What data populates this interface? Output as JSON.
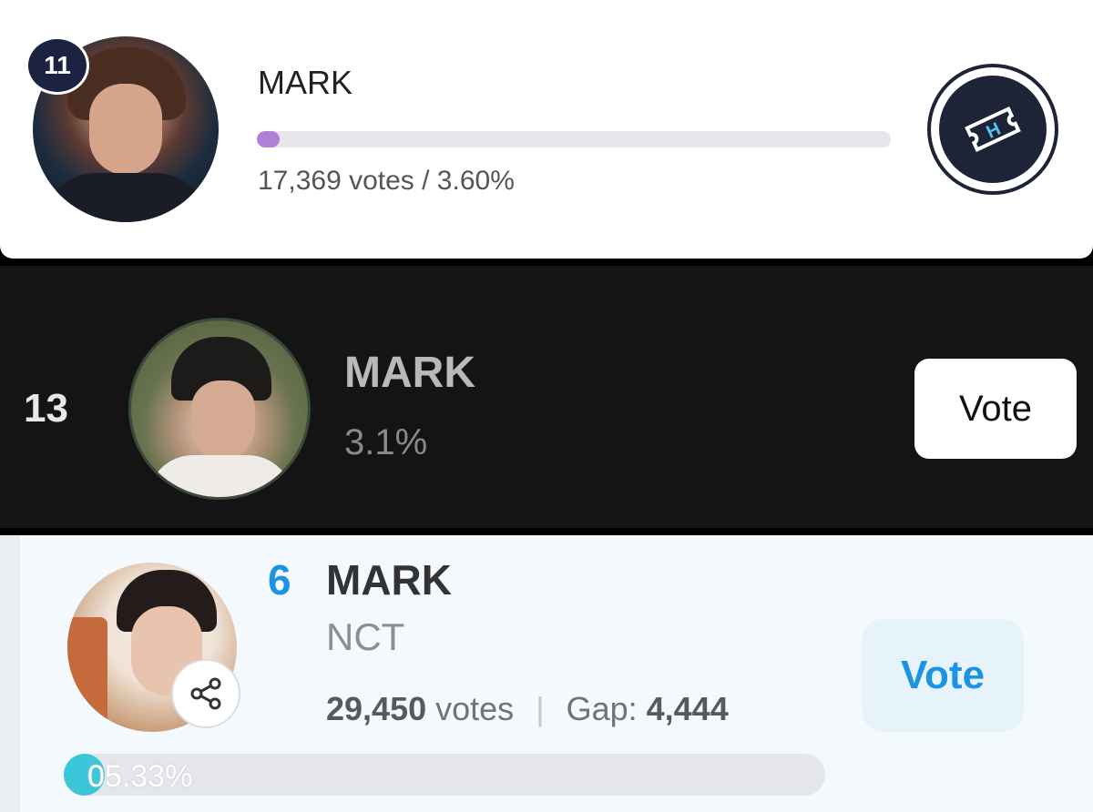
{
  "panel1": {
    "rank": "11",
    "name": "MARK",
    "stats": "17,369 votes / 3.60%",
    "progress_percent": 3.6,
    "bar_color": "#b07fd6",
    "ticket_icon": "ticket-icon"
  },
  "panel2": {
    "rank": "13",
    "name": "MARK",
    "percent": "3.1%",
    "vote_label": "Vote"
  },
  "panel3": {
    "rank": "6",
    "name": "MARK",
    "group": "NCT",
    "votes_value": "29,450",
    "votes_unit": "votes",
    "separator": "|",
    "gap_label": "Gap:",
    "gap_value": "4,444",
    "vote_label": "Vote",
    "progress_label": "05.33%",
    "progress_percent": 5.33,
    "accent_color": "#1d93e3",
    "share_icon": "share-icon"
  }
}
